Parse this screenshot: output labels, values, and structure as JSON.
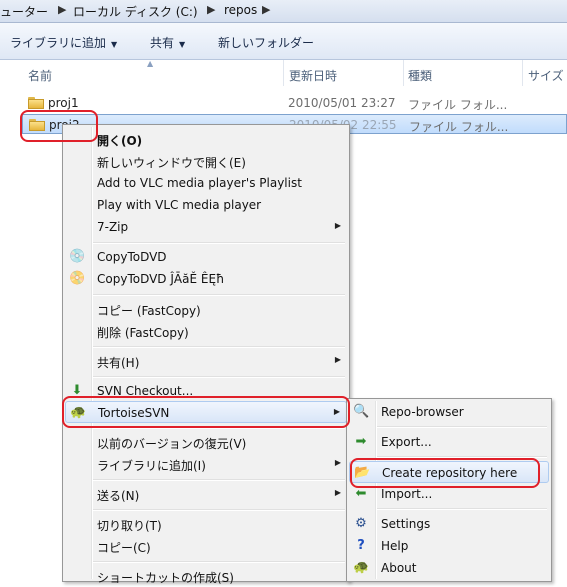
{
  "address": {
    "crumbs": [
      "ューター",
      "ローカル ディスク (C:)",
      "repos"
    ]
  },
  "toolbar": {
    "library_label": "ライブラリに追加",
    "share_label": "共有",
    "new_folder_label": "新しいフォルダー"
  },
  "columns": {
    "name": "名前",
    "date": "更新日時",
    "type": "種類",
    "size": "サイズ"
  },
  "files": [
    {
      "name": "proj1",
      "date": "2010/05/01 23:27",
      "type": "ファイル フォル..."
    },
    {
      "name": "proj2",
      "date": "2010/05/02 22:55",
      "type": "ファイル フォル..."
    }
  ],
  "context_menu": {
    "open": "開く(O)",
    "open_new_window": "新しいウィンドウで開く(E)",
    "vlc_playlist": "Add to VLC media player's Playlist",
    "vlc_play": "Play with VLC media player",
    "sevenzip": "7-Zip",
    "copytodvd": "CopyToDVD",
    "copytodvd2": "CopyToDVD ĴĀăĚ ÊĘħ",
    "copy_fastcopy": "コピー (FastCopy)",
    "delete_fastcopy": "削除 (FastCopy)",
    "share": "共有(H)",
    "svn_checkout": "SVN Checkout...",
    "tortoisesvn": "TortoiseSVN",
    "restore": "以前のバージョンの復元(V)",
    "add_library": "ライブラリに追加(I)",
    "send_to": "送る(N)",
    "cut": "切り取り(T)",
    "copy": "コピー(C)",
    "shortcut": "ショートカットの作成(S)"
  },
  "submenu": {
    "repo_browser": "Repo-browser",
    "export": "Export...",
    "create_repo": "Create repository here",
    "import": "Import...",
    "settings": "Settings",
    "help": "Help",
    "about": "About"
  },
  "colors": {
    "highlight_ring": "#e0202a",
    "selection": "#c1dcfc",
    "menu_bg": "#f1f1f1"
  }
}
